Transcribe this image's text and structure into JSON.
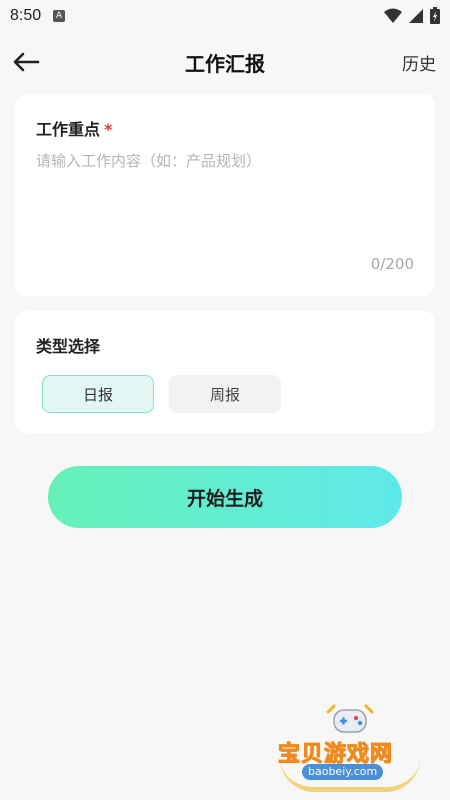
{
  "status_bar": {
    "time": "8:50",
    "notification_letter": "A"
  },
  "nav": {
    "title": "工作汇报",
    "history_label": "历史",
    "back_icon": "arrow-left-icon"
  },
  "focus_card": {
    "label": "工作重点",
    "required_mark": "*",
    "input_value": "",
    "placeholder": "请输入工作内容（如：产品规划）",
    "char_count": "0/200"
  },
  "type_card": {
    "label": "类型选择",
    "options": [
      {
        "label": "日报",
        "selected": true
      },
      {
        "label": "周报",
        "selected": false
      }
    ]
  },
  "generate_button": {
    "label": "开始生成"
  },
  "watermark": {
    "text": "宝贝游戏网",
    "url": "baobeiy.com"
  },
  "colors": {
    "accent_start": "#66f0b8",
    "accent_end": "#5ee9ea",
    "required": "#e23b3b",
    "selected_bg": "#e2f6f4",
    "selected_border": "#7fe6cc"
  }
}
